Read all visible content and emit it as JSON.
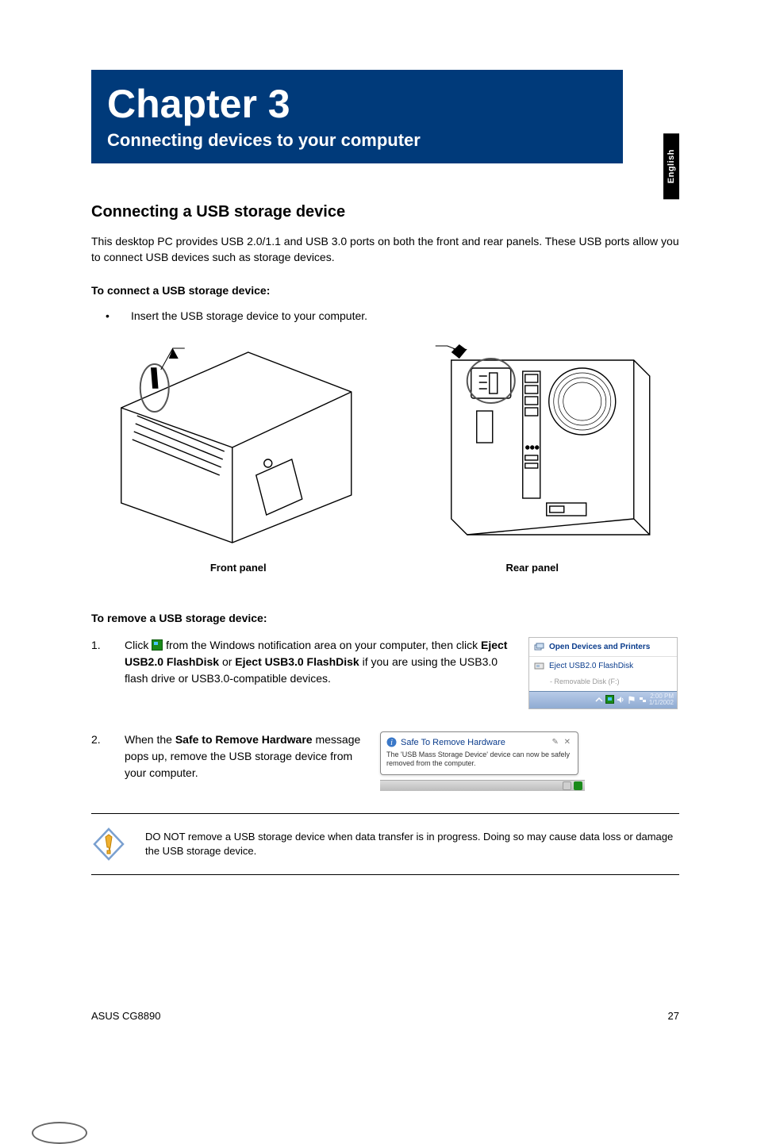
{
  "side_tab": "English",
  "chapter": {
    "title": "Chapter 3",
    "subtitle": "Connecting devices to your computer"
  },
  "section1": {
    "heading": "Connecting a USB storage device",
    "intro": "This desktop PC provides USB 2.0/1.1 and USB 3.0 ports on both the front and rear panels. These USB ports allow you to connect USB devices such as storage devices.",
    "connect_heading": "To connect a USB storage device:",
    "bullet_text": "Insert the USB storage device to your computer.",
    "caption_front": "Front panel",
    "caption_rear": "Rear panel"
  },
  "remove": {
    "heading": "To remove a USB storage device:",
    "step1_pre": "Click ",
    "step1_mid": " from the Windows notification area on your computer, then click ",
    "step1_bold1": "Eject USB2.0 FlashDisk",
    "step1_or": " or ",
    "step1_bold2": "Eject USB3.0 FlashDisk",
    "step1_post": " if you are using the USB3.0 flash drive or USB3.0-compatible devices.",
    "step2_pre": "When the ",
    "step2_bold": "Safe to Remove Hardware",
    "step2_post": " message pops up, remove the USB storage device from your computer."
  },
  "menu": {
    "line1": "Open Devices and Printers",
    "line2": "Eject USB2.0 FlashDisk",
    "line3": "-   Removable Disk (F:)",
    "time1": "2:00 PM",
    "time2": "1/1/2002"
  },
  "balloon": {
    "title": "Safe To Remove Hardware",
    "body": "The 'USB Mass Storage Device' device can now be safely removed from the computer."
  },
  "warning": "DO NOT remove a USB storage device when data transfer is in progress. Doing so may cause data loss or damage the USB storage device.",
  "footer": {
    "left": "ASUS CG8890",
    "right": "27"
  }
}
